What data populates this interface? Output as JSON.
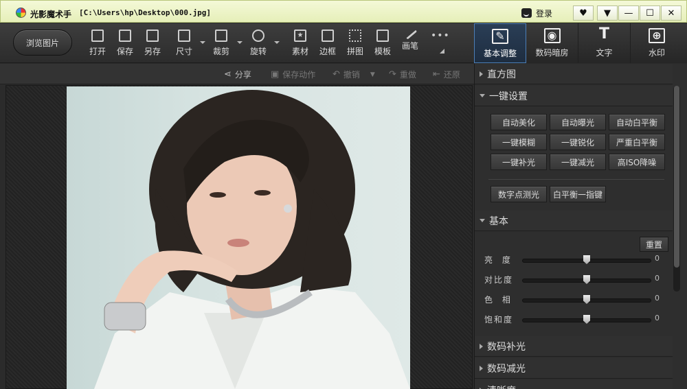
{
  "titlebar": {
    "app_name": "光影魔术手",
    "file_path": "[C:\\Users\\hp\\Desktop\\000.jpg]",
    "login": "登录",
    "buttons": [
      "♥",
      "▼",
      "—",
      "☐",
      "✕"
    ]
  },
  "toolbar": {
    "browse": "浏览图片",
    "tools": [
      {
        "label": "打开",
        "icon": "open-icon"
      },
      {
        "label": "保存",
        "icon": "save-icon"
      },
      {
        "label": "另存",
        "icon": "save-as-icon"
      },
      {
        "label": "尺寸",
        "icon": "resize-icon"
      },
      {
        "label": "裁剪",
        "icon": "crop-icon"
      },
      {
        "label": "旋转",
        "icon": "rotate-icon"
      },
      {
        "label": "素材",
        "icon": "star-icon"
      },
      {
        "label": "边框",
        "icon": "frame-icon"
      },
      {
        "label": "拼图",
        "icon": "collage-icon"
      },
      {
        "label": "模板",
        "icon": "print-icon"
      },
      {
        "label": "画笔",
        "icon": "brush-icon"
      }
    ]
  },
  "right_tabs": [
    {
      "label": "基本调整",
      "glyph": "✎",
      "active": true
    },
    {
      "label": "数码暗房",
      "glyph": "◉",
      "active": false
    },
    {
      "label": "文字",
      "glyph": "T",
      "active": false
    },
    {
      "label": "水印",
      "glyph": "⊕",
      "active": false
    }
  ],
  "subbar": {
    "share": "分享",
    "save_action": "保存动作",
    "undo": "撤销",
    "redo": "重做",
    "restore": "还原"
  },
  "panel": {
    "histogram": "直方图",
    "one_click": "一键设置",
    "fx_buttons": [
      [
        "自动美化",
        "自动曝光",
        "自动白平衡"
      ],
      [
        "一键模糊",
        "一键锐化",
        "严重白平衡"
      ],
      [
        "一键补光",
        "一键减光",
        "高ISO降噪"
      ]
    ],
    "extra_buttons": [
      "数字点测光",
      "白平衡一指键"
    ],
    "basic": "基本",
    "reset": "重置",
    "sliders": [
      {
        "label": "亮  度",
        "value": "0",
        "level": 0.5
      },
      {
        "label": "对比度",
        "value": "0",
        "level": 0.5
      },
      {
        "label": "色  相",
        "value": "0",
        "level": 0.5
      },
      {
        "label": "饱和度",
        "value": "0",
        "level": 0.5
      }
    ],
    "digital_fill": "数码补光",
    "digital_reduce": "数码减光",
    "clarity": "清晰度"
  },
  "colors": {
    "accent": "#4c7fb8",
    "titlebar": "#eef5c8"
  }
}
